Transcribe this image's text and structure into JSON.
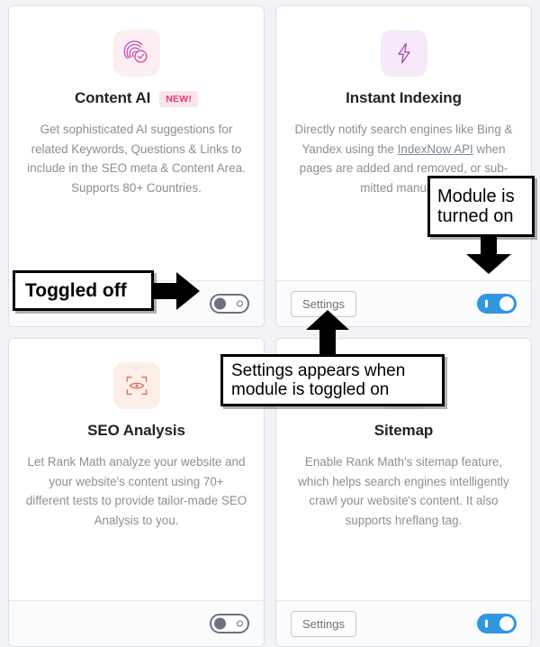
{
  "page": {
    "background_color": "#f1f3f6",
    "card_background": "#ffffff",
    "accent_blue": "#2f97e0",
    "accent_pink": "#e5396b",
    "muted_text": "#8b8f94"
  },
  "cards": [
    {
      "id": "content-ai",
      "icon_name": "content-ai-fingerprint-check-icon",
      "icon_tile_color": "#fdeef4",
      "title": "Content AI",
      "badge": "NEW!",
      "description": "Get sophisticated AI suggestions for related Keywords, Questions & Links to include in the SEO meta & Content Area. Supports 80+ Countries.",
      "settings_label": null,
      "toggle_state": "off"
    },
    {
      "id": "instant-indexing",
      "icon_name": "lightning-bolt-icon",
      "icon_tile_color": "#f6e9fa",
      "title": "Instant Indexing",
      "badge": null,
      "description_before_link": "Directly notify search engines like Bing & Yandex using the ",
      "link_text": "IndexNow API",
      "description_after_link": " when pages are added and removed, or sub­mitted manually.",
      "settings_label": "Settings",
      "toggle_state": "on"
    },
    {
      "id": "seo-analysis",
      "icon_name": "eye-scan-frame-icon",
      "icon_tile_color": "#fdeeea",
      "title": "SEO Analysis",
      "badge": null,
      "description": "Let Rank Math analyze your website and your website's content using 70+ different tests to provide tailor-made SEO Analysis to you.",
      "settings_label": null,
      "toggle_state": "off"
    },
    {
      "id": "sitemap",
      "icon_name": "sitemap-icon",
      "icon_tile_color": "#e9f2fd",
      "title": "Sitemap",
      "badge": null,
      "description": "Enable Rank Math's sitemap feature, which helps search engines intelligently crawl your website's content. It also supports hreflang tag.",
      "settings_label": "Settings",
      "toggle_state": "on"
    }
  ],
  "annotations": [
    {
      "id": "toggled-off",
      "text": "Toggled off",
      "arrow": "right"
    },
    {
      "id": "module-on",
      "text": "Module is\nturned on",
      "arrow": "down"
    },
    {
      "id": "settings-hint",
      "text": "Settings appears when\nmodule is toggled on",
      "arrow": "up"
    }
  ]
}
